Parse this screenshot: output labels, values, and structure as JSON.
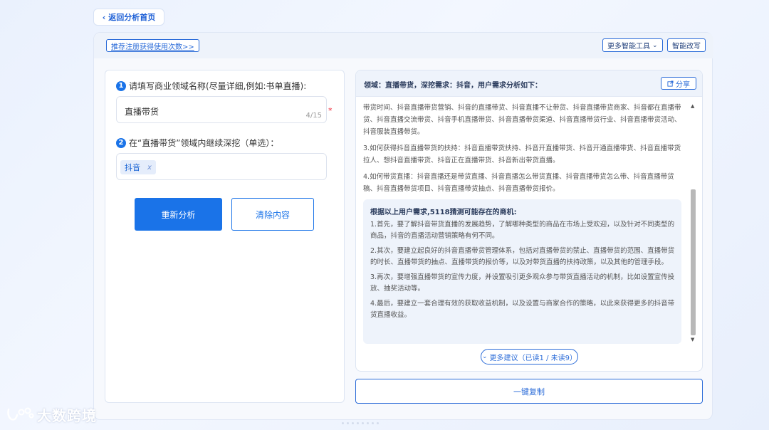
{
  "nav": {
    "back_label": "返回分析首页"
  },
  "topbar": {
    "register_link": "推荐注册获得使用次数>>",
    "more_tools": "更多智能工具",
    "smart_rewrite": "智能改写"
  },
  "form": {
    "step1_num": "1",
    "step1_label": "请填写商业领域名称(尽量详细,例如:书单直播):",
    "field_value": "直播带货",
    "field_count": "4/15",
    "required_mark": "*",
    "step2_num": "2",
    "step2_label": "在“直播带货”领域内继续深挖（单选）：",
    "tag_label": "抖音",
    "tag_close": "x",
    "reanalyze": "重新分析",
    "clear": "清除内容"
  },
  "result": {
    "header": "领域：直播带货，深挖需求：抖音，用户需求分析如下：",
    "share": "分享",
    "paragraphs": [
      "带货时间、抖音直播带货营销、抖音的直播带货、抖音直播不让带货、抖音直播带货商家、抖音都在直播带货、抖音直播交流带货、抖音手机直播带货、抖音直播带货渠道、抖音直播带货行业、抖音直播带货活动、抖音服装直播带货。",
      "3.如何获得抖音直播带货的扶持：抖音直播带货扶持、抖音开直播带货、抖音开通直播带货、抖音直播带货拉人、想抖音直播带货、抖音正在直播带货、抖音新出带货直播。",
      "4.如何带货直播：抖音直播还是带货直播、抖音直播怎么带货直播、抖音直播带货怎么带、抖音直播带货稿、抖音直播带货项目、抖音直播带货抽点、抖音直播带货报价。"
    ],
    "biz_title": "根据以上用户需求,5118猜测可能存在的商机:",
    "biz_paragraphs": [
      "1.首先，要了解抖音带货直播的发展趋势，了解哪种类型的商品在市场上受欢迎，以及针对不同类型的商品，抖音的直播活动营销策略有何不同。",
      "2.其次，要建立起良好的抖音直播带货管理体系，包括对直播带货的禁止、直播带货的范围、直播带货的时长、直播带货的抽点、直播带货的报价等，以及对带货直播的扶持政策，以及其他的管理手段。",
      "3.再次，要增强直播带货的宣传力度，并设置吸引更多观众参与带货直播活动的机制，比如设置宣传投放、抽奖活动等。",
      "4.最后，要建立一套合理有效的获取收益机制，以及设置与商家合作的策略，以此来获得更多的抖音带货直播收益。"
    ],
    "more_suggestions": "更多建议（已读1 / 未读9）",
    "copy_all": "一键复制"
  },
  "brand": {
    "logo_text": "大数跨境"
  },
  "colors": {
    "primary": "#1a73e8",
    "link": "#2a6bd8",
    "panel_bg": "#eef3fb"
  },
  "icons": [
    "chevron-left-icon",
    "chevron-down-icon",
    "share-icon",
    "scroll-up-icon",
    "scroll-down-icon",
    "logo-icon"
  ]
}
